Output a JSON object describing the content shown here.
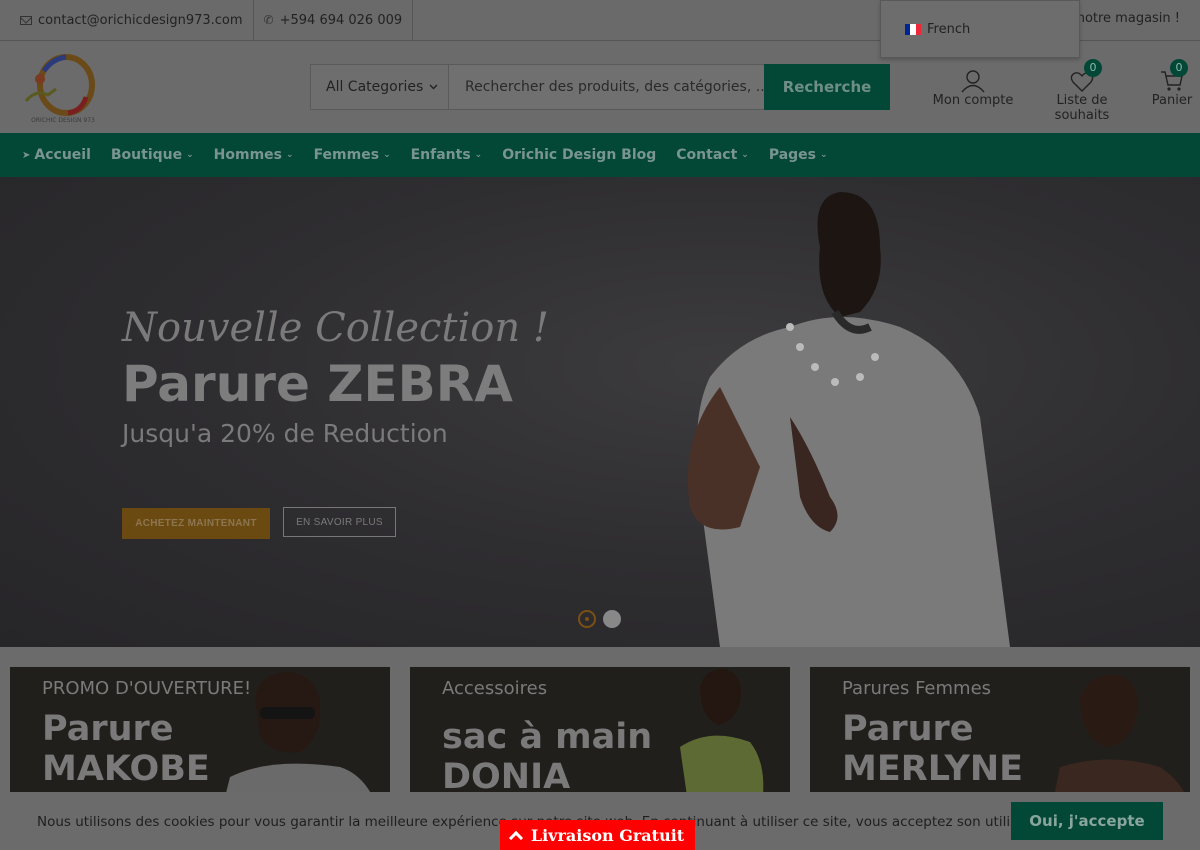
{
  "topbar": {
    "email": "contact@orichicdesign973.com",
    "phone": "+594 694 026 009",
    "store_text": "notre magasin !"
  },
  "language": {
    "label": "French",
    "flag_colors": [
      "#002395",
      "#ffffff",
      "#ed2939"
    ]
  },
  "header": {
    "logo_text": "ORICHIC DESIGN 973",
    "search": {
      "category": "All Categories",
      "placeholder": "Rechercher des produits, des catégories, ...",
      "button": "Recherche"
    },
    "account": "Mon compte",
    "wishlist": "Liste de souhaits",
    "wishlist_count": "0",
    "cart": "Panier",
    "cart_count": "0"
  },
  "nav": [
    "Accueil",
    "Boutique",
    "Hommes",
    "Femmes",
    "Enfants",
    "Orichic Design Blog",
    "Contact",
    "Pages"
  ],
  "hero": {
    "script_title": "Nouvelle Collection !",
    "title": "Parure ZEBRA",
    "subtitle": "Jusqu'a 20% de Reduction",
    "button_primary": "ACHETEZ MAINTENANT",
    "button_secondary": "EN SAVOIR PLUS"
  },
  "banners": [
    {
      "pre": "PROMO D'OUVERTURE!",
      "line1": "Parure",
      "line2": "MAKOBE"
    },
    {
      "pre": "Accessoires",
      "line1": "sac à main",
      "line2": "DONIA"
    },
    {
      "pre": "Parures Femmes",
      "line1": "Parure",
      "line2": "MERLYNE"
    }
  ],
  "cookie": {
    "text": "Nous utilisons des cookies pour vous garantir la meilleure expérience sur notre site web. En continuant à utiliser ce site, vous acceptez son utilisation.",
    "button": "Oui, j'accepte"
  },
  "shipping_tab": "Livraison Gratuit",
  "colors": {
    "brand_green": "#034737",
    "accent_orange": "#c47a1e",
    "shipping_red": "#ff0000"
  }
}
